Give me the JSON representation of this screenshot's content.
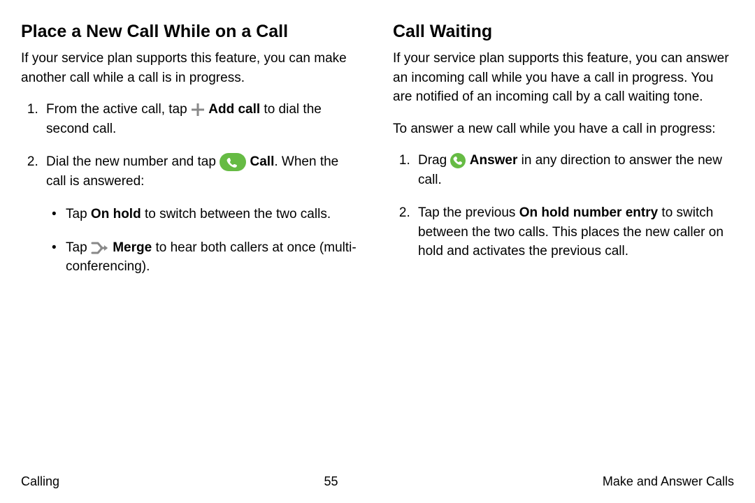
{
  "left": {
    "heading": "Place a New Call While on a Call",
    "intro": "If your service plan supports this feature, you can make another call while a call is in progress.",
    "step1_a": "From the active call, tap ",
    "step1_b_bold": "Add call",
    "step1_c": " to dial the second call.",
    "step2_a": "Dial the new number and tap ",
    "step2_b_bold": "Call",
    "step2_c": ". When the call is answered:",
    "sub1_a": "Tap ",
    "sub1_b_bold": "On hold",
    "sub1_c": " to switch between the two calls.",
    "sub2_a": "Tap ",
    "sub2_b_bold": "Merge",
    "sub2_c": " to hear both callers at once (multi-conferencing)."
  },
  "right": {
    "heading": "Call Waiting",
    "intro": "If your service plan supports this feature, you can answer an incoming call while you have a call in progress. You are notified of an incoming call by a call waiting tone.",
    "lead": "To answer a new call while you have a call in progress:",
    "step1_a": "Drag ",
    "step1_b_bold": "Answer",
    "step1_c": " in any direction to answer the new call.",
    "step2_a": "Tap the previous ",
    "step2_b_bold": "On hold number entry",
    "step2_c": " to switch between the two calls. This places the new caller on hold and activates the previous call."
  },
  "footer": {
    "left": "Calling",
    "center": "55",
    "right": "Make and Answer Calls"
  },
  "colors": {
    "green": "#66bb44",
    "gray": "#888888"
  }
}
